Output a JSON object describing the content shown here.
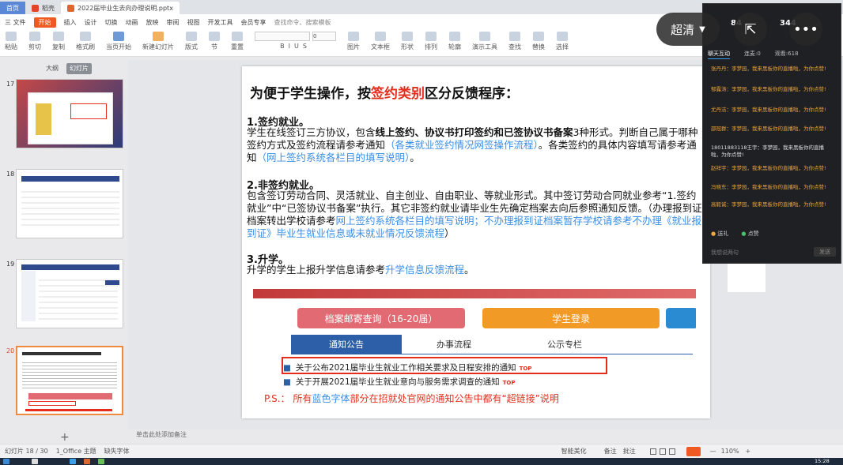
{
  "tabs": {
    "home": "首页",
    "docs": "稻壳",
    "file": "2022届毕业生去向办理说明.pptx"
  },
  "menu": {
    "file": "三 文件",
    "items": [
      "开始",
      "插入",
      "设计",
      "切换",
      "动画",
      "放映",
      "审阅",
      "视图",
      "开发工具",
      "会员专享"
    ],
    "search": "查找命令、搜索模板"
  },
  "ribbon": {
    "paste": "粘贴",
    "cut": "剪切",
    "copy": "复制",
    "format": "格式刷",
    "from_current": "当页开始",
    "new_slide": "新建幻灯片",
    "layout": "版式",
    "section": "节",
    "reset": "重置",
    "font_size": "0",
    "textbox": "文本框",
    "shape": "形状",
    "arrange": "排列",
    "outline": "轮廓",
    "present_tools": "演示工具",
    "replace": "替换",
    "select": "选择",
    "picture": "图片",
    "find": "查找"
  },
  "view_toggle": {
    "outline": "大纲",
    "slides": "幻灯片"
  },
  "thumbnails": [
    {
      "num": "17"
    },
    {
      "num": "18"
    },
    {
      "num": "19"
    },
    {
      "num": "20"
    }
  ],
  "slide": {
    "title_pre": "为便于学生操作，按",
    "title_red": "签约类别",
    "title_post": "区分反馈程序：",
    "s1_head": "1.签约就业。",
    "s1_a": "学生在线签订三方协议，包含",
    "s1_bold": "线上签约、协议书打印签约和已签协议书备案",
    "s1_b": "3种形式。判断自己属于哪种签约方式及签约流程请参考通知",
    "s1_link1": "（各类就业签约情况网签操作流程）",
    "s1_c": "。各类签约的具体内容填写请参考通知",
    "s1_link2": "（网上签约系统各栏目的填写说明）",
    "s1_d": "。",
    "s2_head": "2.非签约就业。",
    "s2_a": "包含签订劳动合同、灵活就业、自主创业、自由职业、等就业形式。其中签订劳动合同就业参考“1.签约就业”中“已签协议书备案”执行。其它非签约就业请毕业生先确定档案去向后参照通知反馈。（办理报到证档案转出学校请参考",
    "s2_link1": "网上签约系统各栏目的填写说明",
    "s2_b": "；",
    "s2_link2": "不办理报到证档案暂存学校请参考不办理《就业报到证》毕业生就业信息或未就业情况反馈流程",
    "s2_c": "）",
    "s3_head": "3.升学。",
    "s3_a": "升学的学生上报升学信息请参考",
    "s3_link": "升学信息反馈流程",
    "s3_b": "。",
    "web": {
      "btn1": "档案邮寄查询（16-20届）",
      "btn2": "学生登录",
      "tab1": "通知公告",
      "tab2": "办事流程",
      "tab3": "公示专栏",
      "item1": "关于公布2021届毕业生就业工作相关要求及日程安排的通知",
      "item2": "关于开展2021届毕业生就业意向与服务需求调查的通知",
      "top": "TOP"
    },
    "ps_pre": "P.S.：  所有",
    "ps_blue": "蓝色字体",
    "ps_post": "部分在招就处官网的通知公告中都有“超链接”说明"
  },
  "notes_placeholder": "单击此处添加备注",
  "status": {
    "slide_pos": "幻灯片 18 / 30",
    "theme": "1_Office 主题",
    "font_missing": "缺失字体",
    "beautify": "智能美化",
    "notes": "备注",
    "comment": "批注",
    "zoom": "110%",
    "time": "15:28"
  },
  "chat": {
    "tabs": [
      "聊天互动",
      "连麦:0",
      "观看:618"
    ],
    "messages": [
      "张丹丹：李梦园，我来黑板你的直播啦，为你点赞!",
      "郁露涛：李梦园，我来黑板你的直播啦，为你点赞!",
      "尤丹洁：李梦园，我来黑板你的直播啦，为你点赞!",
      "邵冠群：李梦园，我来黑板你的直播啦，为你点赞!",
      "18011883118王宇：李梦园，我来黑板你的直播啦，为你点赞!",
      "赵祥宇：李梦园，我来黑板你的直播啦，为你点赞!",
      "冯晓东：李梦园，我来黑板你的直播啦，为你点赞!",
      "高毅诚：李梦园，我来黑板你的直播啦，为你点赞!"
    ],
    "gift": "送礼",
    "like": "点赞",
    "input_placeholder": "我想说两句",
    "send": "发送"
  },
  "overlay": {
    "quality": "超清",
    "num1": "84",
    "num2": "344"
  }
}
